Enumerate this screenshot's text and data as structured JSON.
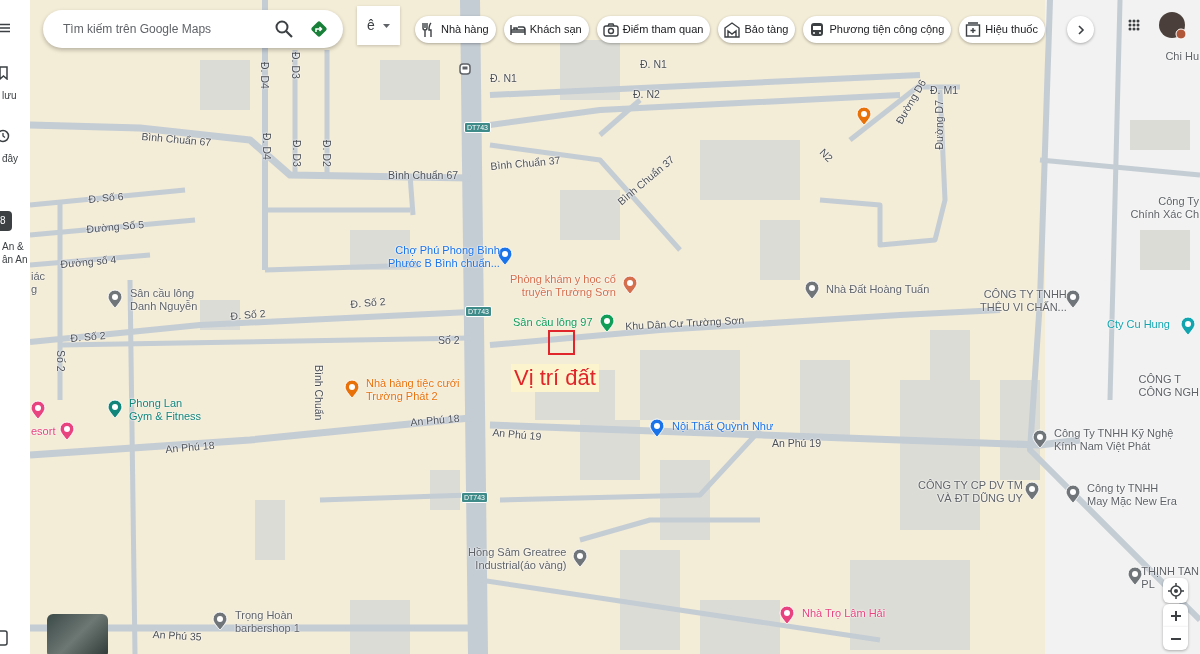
{
  "search": {
    "placeholder": "Tìm kiếm trên Google Maps"
  },
  "layer_toggle": {
    "label": "ê"
  },
  "chips": [
    {
      "label": "Nhà hàng",
      "kind": "fork-knife"
    },
    {
      "label": "Khách sạn",
      "kind": "bed"
    },
    {
      "label": "Điểm tham quan",
      "kind": "camera"
    },
    {
      "label": "Bảo tàng",
      "kind": "museum"
    },
    {
      "label": "Phương tiện công cộng",
      "kind": "bus"
    },
    {
      "label": "Hiệu thuốc",
      "kind": "pharmacy"
    }
  ],
  "sidebar": [
    {
      "kind": "bookmark",
      "lines": [
        "lưu"
      ]
    },
    {
      "kind": "clock",
      "lines": [
        "đây"
      ]
    },
    {
      "kind": "app",
      "badge": "8",
      "lines": [
        "An &",
        "ân An"
      ]
    }
  ],
  "streets": [
    {
      "text": "Bình Chuẩn 67"
    },
    {
      "text": "Bình Chuẩn 67"
    },
    {
      "text": "Đ. D4"
    },
    {
      "text": "Đ. D4"
    },
    {
      "text": "Đ. D3"
    },
    {
      "text": "Đ. D3"
    },
    {
      "text": "Đ. D2"
    },
    {
      "text": "Đ. Số 6"
    },
    {
      "text": "Đường Số 5"
    },
    {
      "text": "Đường số 4"
    },
    {
      "text": "Đ. Số 2"
    },
    {
      "text": "Đ. Số 2"
    },
    {
      "text": "Đ. Số 2"
    },
    {
      "text": "Số 2"
    },
    {
      "text": "Số 2"
    },
    {
      "text": "Bình Chuẩn 37"
    },
    {
      "text": "Bình Chuẩn 37"
    },
    {
      "text": "Đ. N1"
    },
    {
      "text": "Đ. N1"
    },
    {
      "text": "Đ. N2"
    },
    {
      "text": "N2"
    },
    {
      "text": "Đường D6"
    },
    {
      "text": "Đ. M1"
    },
    {
      "text": "Đường D7"
    },
    {
      "text": "Khu Dân Cư Trường Sơn"
    },
    {
      "text": "Bình Chuẩn"
    },
    {
      "text": "An Phú 18"
    },
    {
      "text": "An Phú 18"
    },
    {
      "text": "An Phú 19"
    },
    {
      "text": "An Phú 19"
    },
    {
      "text": "An Phú 35"
    }
  ],
  "route_shields": [
    "DT743",
    "DT743",
    "DT743"
  ],
  "places": [
    {
      "lines": [
        "Chợ Phú Phong Bình",
        "Phước B Bình chuẩn..."
      ],
      "color": "#1a73e8"
    },
    {
      "lines": [
        "Phòng khám y học cổ",
        "truyền Trường Sơn"
      ],
      "color": "#d56e4c"
    },
    {
      "lines": [
        "Nhà Đất Hoàng Tuấn"
      ],
      "color": "#70757a"
    },
    {
      "lines": [
        "CÔNG TY TNHH",
        "THÊU VI CHẤN..."
      ],
      "color": "#70757a"
    },
    {
      "lines": [
        "Cty Cu Hung"
      ],
      "color": "#12a4af"
    },
    {
      "lines": [
        "Sân cầu lông",
        "Danh Nguyễn"
      ],
      "color": "#70757a"
    },
    {
      "lines": [
        "Sân cầu lông 97"
      ],
      "color": "#0f9d58"
    },
    {
      "lines": [
        "Nhà hàng tiệc cưới",
        "Trường Phát 2"
      ],
      "color": "#e8710a"
    },
    {
      "lines": [
        "Phong Lan",
        "Gym & Fitness"
      ],
      "color": "#12857a"
    },
    {
      "lines": [
        "esort"
      ],
      "color": "#e8437f"
    },
    {
      "lines": [
        "Nội Thất Quỳnh Như"
      ],
      "color": "#1a73e8"
    },
    {
      "lines": [
        "Công Ty TNHH Kỹ Nghệ",
        "Kính Nam Việt Phát"
      ],
      "color": "#70757a"
    },
    {
      "lines": [
        "CÔNG TY CP DV TM",
        "VÀ ĐT DŨNG UY"
      ],
      "color": "#70757a"
    },
    {
      "lines": [
        "Công ty TNHH",
        "May Mặc New Era"
      ],
      "color": "#70757a"
    },
    {
      "lines": [
        "Hồng Sâm Greatree",
        "Industrial(áo vàng)"
      ],
      "color": "#70757a"
    },
    {
      "lines": [
        "THỊNH TAN",
        "PL"
      ],
      "color": "#70757a"
    },
    {
      "lines": [
        "Trọng Hoàn",
        "barbershop 1"
      ],
      "color": "#70757a"
    },
    {
      "lines": [
        "Nhà Trọ Lâm Hải"
      ],
      "color": "#e8437f"
    }
  ],
  "area_labels": [
    {
      "lines": [
        "Chi Hu"
      ]
    },
    {
      "lines": [
        "Công Ty",
        "Chính Xác Ch"
      ]
    },
    {
      "lines": [
        "CÔNG T",
        "CÔNG NGH"
      ]
    },
    {
      "lines": [
        "iác",
        "g"
      ]
    }
  ],
  "extra_pins": [
    {
      "color": "#e8437f"
    },
    {
      "color": "#e8710a"
    }
  ],
  "annotation": {
    "text": "Vị trí đất"
  }
}
